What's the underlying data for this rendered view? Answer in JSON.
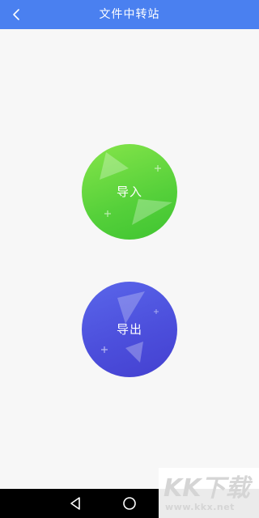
{
  "header": {
    "title": "文件中转站",
    "back_icon": "chevron-left-icon"
  },
  "actions": {
    "import_label": "导入",
    "export_label": "导出"
  },
  "colors": {
    "header_bg": "#4a80f0",
    "import_bg": "#55d03a",
    "export_bg": "#4c4fdc"
  },
  "system_nav": {
    "back_icon": "triangle-back-icon",
    "home_icon": "circle-home-icon"
  },
  "watermark": {
    "main": "KK下载",
    "sub": "www.kkx.net"
  }
}
